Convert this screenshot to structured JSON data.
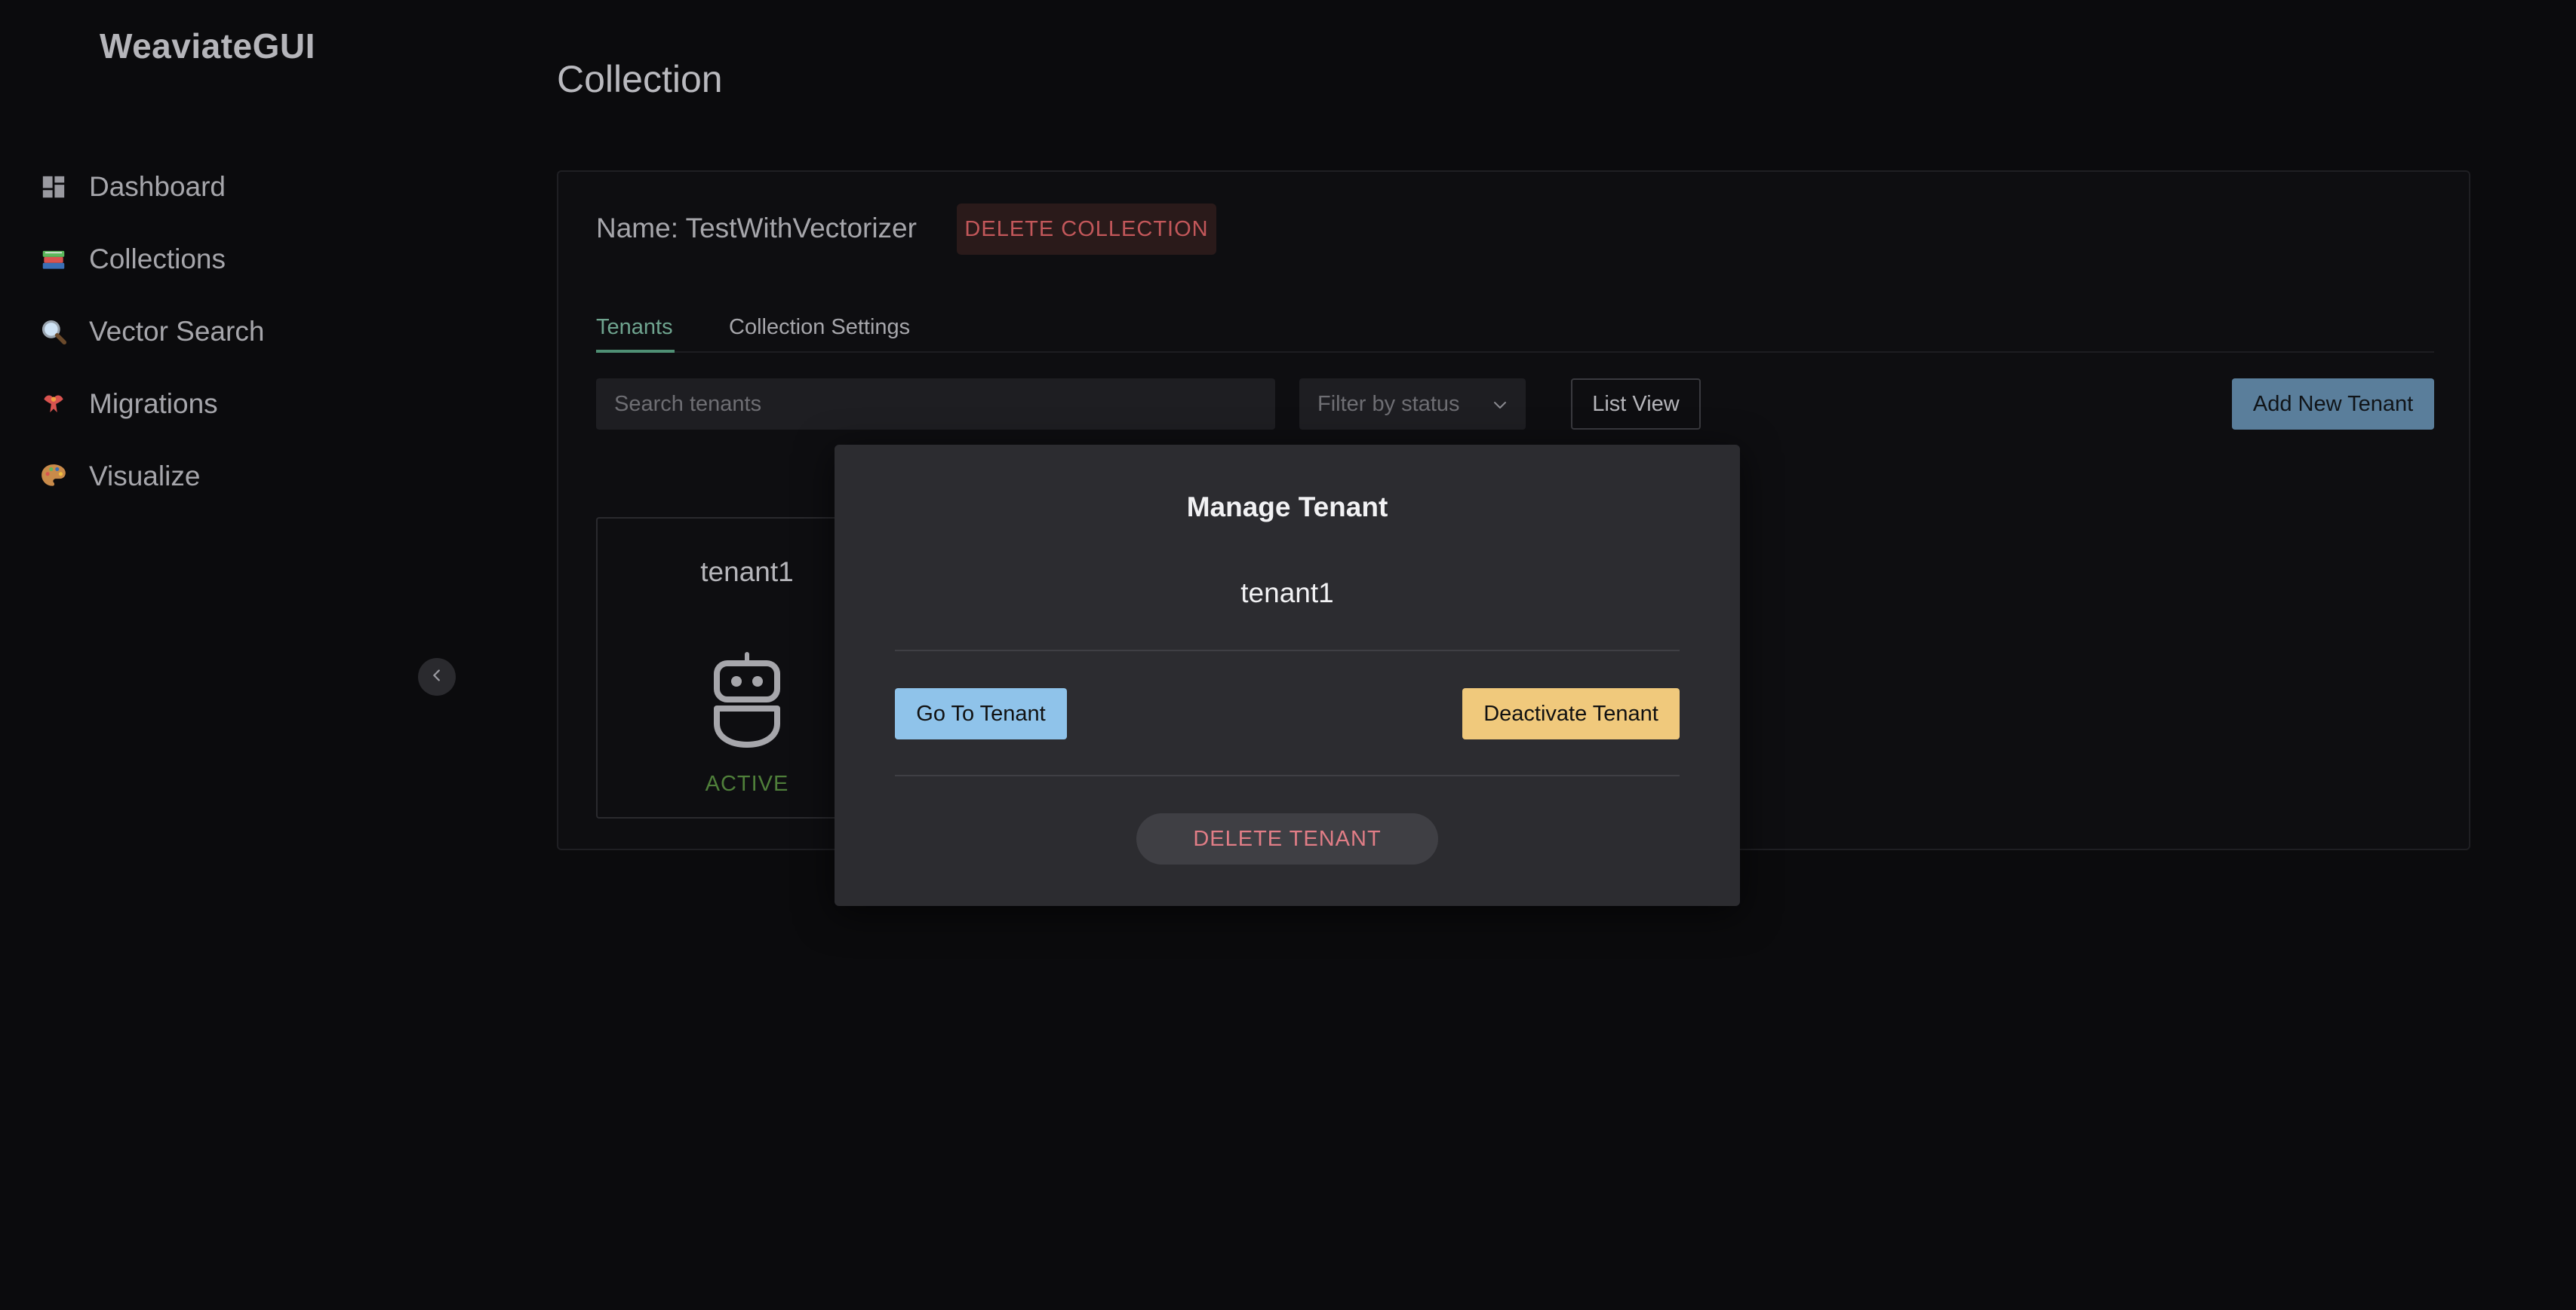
{
  "app": {
    "brand": "WeaviateGUI"
  },
  "sidebar": {
    "items": [
      {
        "label": "Dashboard",
        "icon": "dashboard-icon"
      },
      {
        "label": "Collections",
        "icon": "books-icon"
      },
      {
        "label": "Vector Search",
        "icon": "magnifier-icon"
      },
      {
        "label": "Migrations",
        "icon": "bird-icon"
      },
      {
        "label": "Visualize",
        "icon": "palette-icon"
      }
    ],
    "collapse_icon": "chevron-left-icon"
  },
  "main": {
    "title": "Collection",
    "collection_name": "Name: TestWithVectorizer",
    "delete_collection_label": "DELETE COLLECTION",
    "tabs": [
      {
        "label": "Tenants",
        "active": true
      },
      {
        "label": "Collection Settings",
        "active": false
      }
    ],
    "search": {
      "placeholder": "Search tenants",
      "value": ""
    },
    "filter": {
      "placeholder": "Filter by status"
    },
    "view_toggle_label": "List View",
    "add_tenant_label": "Add New Tenant",
    "tenants": [
      {
        "name": "tenant1",
        "status": "ACTIVE",
        "icon": "robot-icon"
      }
    ]
  },
  "modal": {
    "title": "Manage Tenant",
    "tenant_name": "tenant1",
    "go_to_label": "Go To Tenant",
    "deactivate_label": "Deactivate Tenant",
    "delete_label": "DELETE TENANT"
  },
  "colors": {
    "background": "#0b0b0d",
    "accent_tab": "#6fa48f",
    "status_active": "#4f7f3a",
    "primary_button": "#5a7e9b",
    "go_to_button": "#8fc3ea",
    "deactivate_button": "#f0c97c",
    "danger_text": "#e07d86"
  }
}
